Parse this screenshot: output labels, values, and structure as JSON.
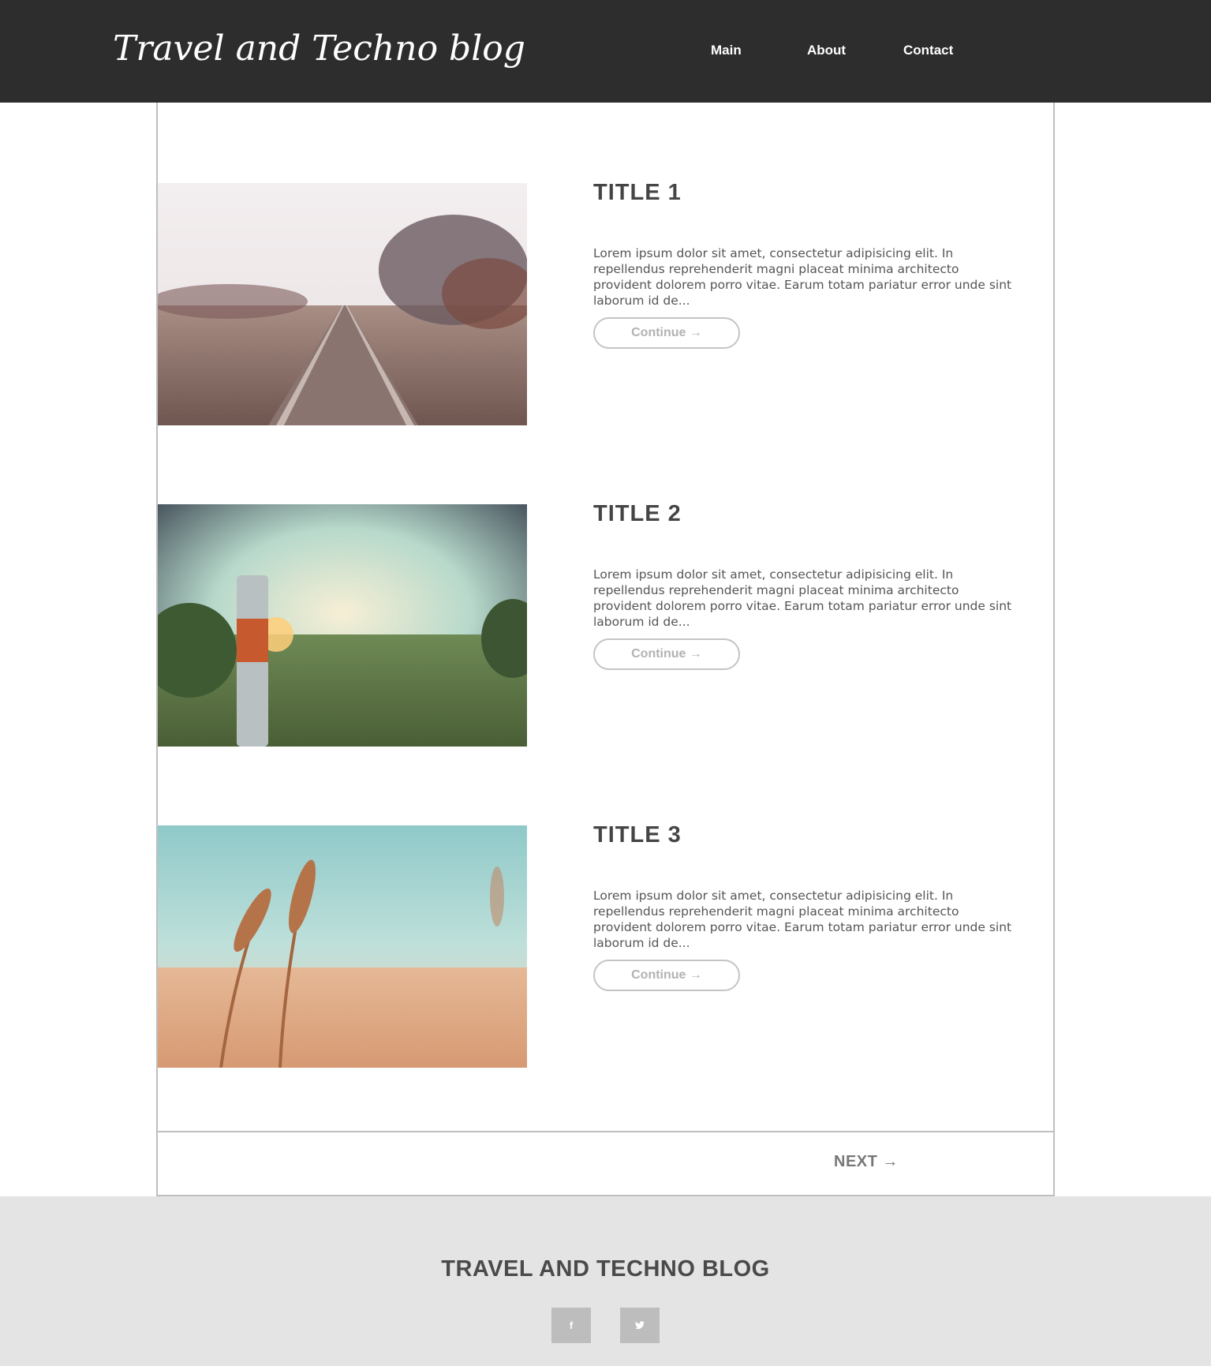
{
  "header": {
    "logo": "Travel and Techno blog",
    "nav": [
      "Main",
      "About",
      "Contact"
    ]
  },
  "posts": [
    {
      "title": "TITLE 1",
      "excerpt": "Lorem ipsum dolor sit amet, consectetur adipisicing elit. In repellendus reprehenderit magni placeat minima architecto provident dolorem porro vitae. Earum totam pariatur error unde sint laborum id de...",
      "button": "Continue →",
      "image": "railway-tracks-photo"
    },
    {
      "title": "TITLE 2",
      "excerpt": "Lorem ipsum dolor sit amet, consectetur adipisicing elit. In repellendus reprehenderit magni placeat minima architecto provident dolorem porro vitae. Earum totam pariatur error unde sint laborum id de...",
      "button": "Continue →",
      "image": "field-sunset-post-photo"
    },
    {
      "title": "TITLE 3",
      "excerpt": "Lorem ipsum dolor sit amet, consectetur adipisicing elit. In repellendus reprehenderit magni placeat minima architecto provident dolorem porro vitae. Earum totam pariatur error unde sint laborum id de...",
      "button": "Continue →",
      "image": "wheat-field-photo"
    }
  ],
  "pager": {
    "next": "NEXT →"
  },
  "footer": {
    "title": "TRAVEL AND TECHNO BLOG",
    "social": [
      {
        "icon": "facebook-icon",
        "glyph": "f"
      },
      {
        "icon": "twitter-icon",
        "glyph": "🐦"
      }
    ]
  },
  "colors": {
    "header_bg": "#2d2d2d",
    "footer_bg": "#e4e4e4",
    "title_text": "#454545",
    "button_border": "#c4c4c4",
    "social_bg": "#bdbdbd"
  }
}
